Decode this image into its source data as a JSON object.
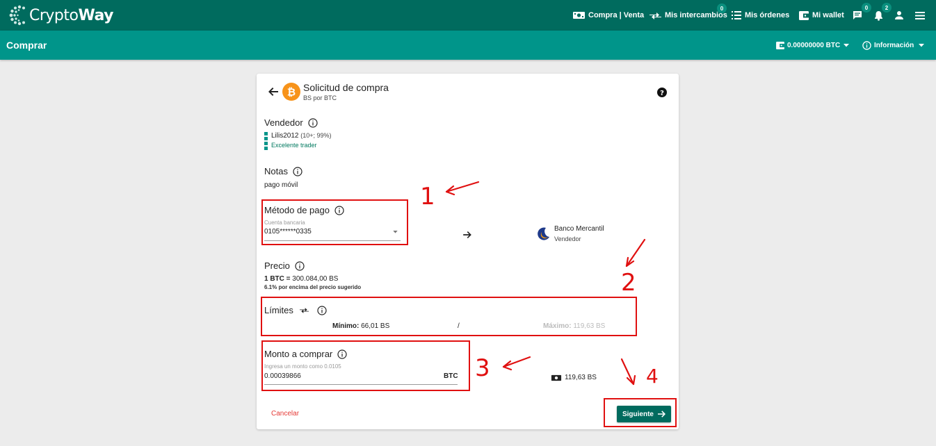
{
  "app": {
    "logo_text_light": "Crypto",
    "logo_text_bold": "Way"
  },
  "nav": {
    "buy_sell": "Compra | Venta",
    "exchanges": "Mis intercambios",
    "exchanges_badge": "0",
    "orders": "Mis órdenes",
    "wallet": "Mi wallet",
    "chat_badge": "0",
    "notifications_badge": "2"
  },
  "subbar": {
    "title": "Comprar",
    "balance": "0.00000000 BTC",
    "info": "Información"
  },
  "card": {
    "title": "Solicitud de compra",
    "subtitle": "BS por BTC",
    "seller_label": "Vendedor",
    "seller_name": "Lilis2012",
    "seller_stats": "(10+; 99%)",
    "seller_rank": "Excelente trader",
    "notes_label": "Notas",
    "notes_value": "pago móvil",
    "payment_label": "Método de pago",
    "payment_field_label": "Cuenta bancaria",
    "payment_value": "0105******0335",
    "bank_name": "Banco Mercantil",
    "bank_role": "Vendedor",
    "price_label": "Precio",
    "price_btc": "1 BTC =",
    "price_value": "300.084,00 BS",
    "price_note": "6.1% por encima del precio sugerido",
    "limits_label": "Límites",
    "min_label": "Mínimo:",
    "min_value": "66,01 BS",
    "limits_sep": "/",
    "max_label": "Máximo:",
    "max_value": "119,63 BS",
    "amount_label": "Monto a comprar",
    "amount_hint": "Ingresa un monto como 0.0105",
    "amount_value": "0.00039866",
    "amount_unit": "BTC",
    "amount_bs": "119,63 BS",
    "cancel": "Cancelar",
    "next": "Siguiente"
  },
  "annotations": {
    "n1": "1",
    "n2": "2",
    "n3": "3",
    "n4": "4"
  },
  "colors": {
    "topbar": "#006b5e",
    "subbar": "#00958a",
    "annotation": "#e01010",
    "bitcoin": "#f7931a"
  }
}
